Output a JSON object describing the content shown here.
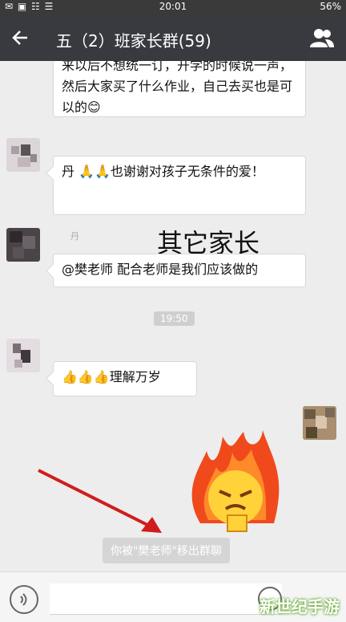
{
  "status_bar": {
    "time": "20:01",
    "battery": "56%",
    "left_icons": "✉ ▣ ☷ ☰"
  },
  "header": {
    "title": "五（2）班家长群(59)"
  },
  "messages": [
    {
      "text": "来以后不想统一订，开学的时候说一声，然后大家买了什么作业，自己去买也是可以的😊"
    },
    {
      "sender": "",
      "text": "丹 🙏🙏也谢谢对孩子无条件的爱！"
    },
    {
      "sender": "丹",
      "text": "@樊老师 配合老师是我们应该做的"
    },
    {
      "text": "👍👍👍理解万岁"
    }
  ],
  "overlay_label": "其它家长",
  "timestamp": "19:50",
  "system_message": "你被\"樊老师\"移出群聊",
  "watermark": "新世纪手游"
}
